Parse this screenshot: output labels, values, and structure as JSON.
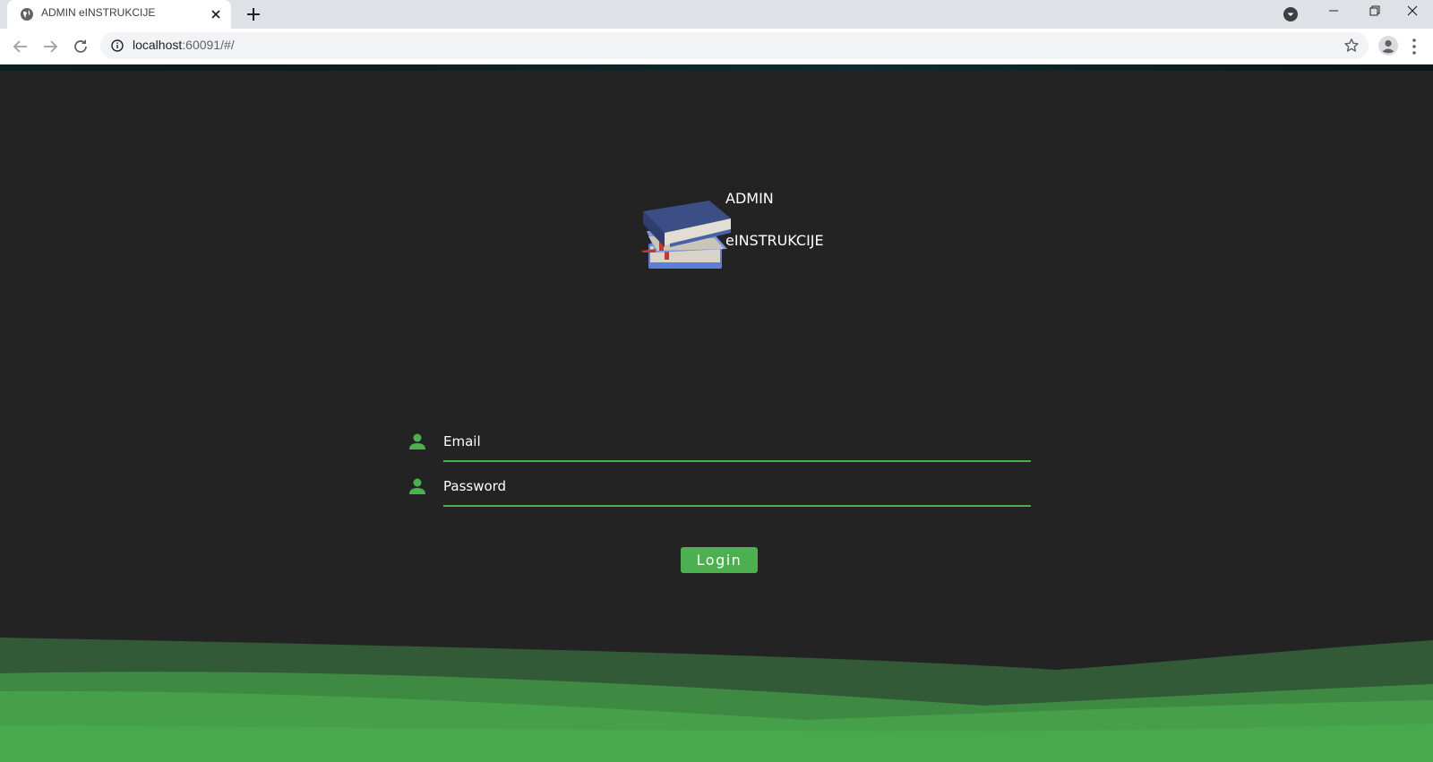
{
  "browser": {
    "tab_title": "ADMIN eINSTRUKCIJE",
    "url_host": "localhost",
    "url_rest": ":60091/#/"
  },
  "logo": {
    "line1": "ADMIN",
    "line2": "eINSTRUKCIJE",
    "image": "books-stack-icon"
  },
  "form": {
    "email_placeholder": "Email",
    "password_placeholder": "Password",
    "field_icon": "person-icon",
    "login_label": "Login"
  },
  "colors": {
    "background": "#232323",
    "accent": "#4caf50",
    "wave_dark": "#335a36",
    "wave_mid": "#3f8a43",
    "wave_light": "#47a84c"
  }
}
